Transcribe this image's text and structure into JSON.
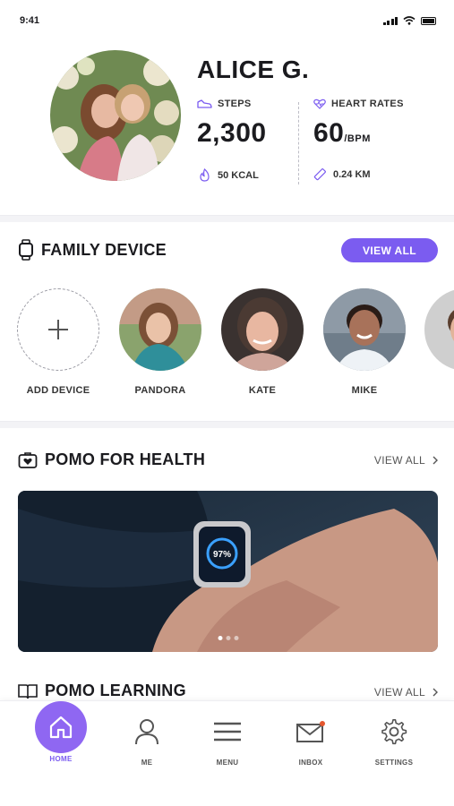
{
  "status_bar": {
    "time": "9:41"
  },
  "profile": {
    "name": "ALICE G.",
    "steps": {
      "label": "STEPS",
      "value": "2,300"
    },
    "heart": {
      "label": "HEART RATES",
      "value": "60",
      "unit": "/BPM"
    },
    "calories": "50 KCAL",
    "distance": "0.24 KM"
  },
  "family": {
    "title": "FAMILY DEVICE",
    "view_all": "VIEW ALL",
    "devices": [
      {
        "label": "ADD DEVICE"
      },
      {
        "label": "PANDORA"
      },
      {
        "label": "KATE"
      },
      {
        "label": "MIKE"
      }
    ]
  },
  "health": {
    "title": "POMO FOR HEALTH",
    "view_all": "VIEW ALL",
    "watch_reading": "97%",
    "carousel_pages": 3,
    "carousel_active": 1
  },
  "learning": {
    "title": "POMO LEARNING",
    "view_all": "VIEW ALL"
  },
  "nav": {
    "items": [
      {
        "label": "HOME",
        "icon": "home-icon",
        "active": true
      },
      {
        "label": "ME",
        "icon": "person-icon"
      },
      {
        "label": "MENU",
        "icon": "menu-icon"
      },
      {
        "label": "INBOX",
        "icon": "mail-icon"
      },
      {
        "label": "SETTINGS",
        "icon": "gear-icon"
      }
    ]
  },
  "colors": {
    "accent": "#7B5CF0",
    "notification": "#E4572E"
  }
}
